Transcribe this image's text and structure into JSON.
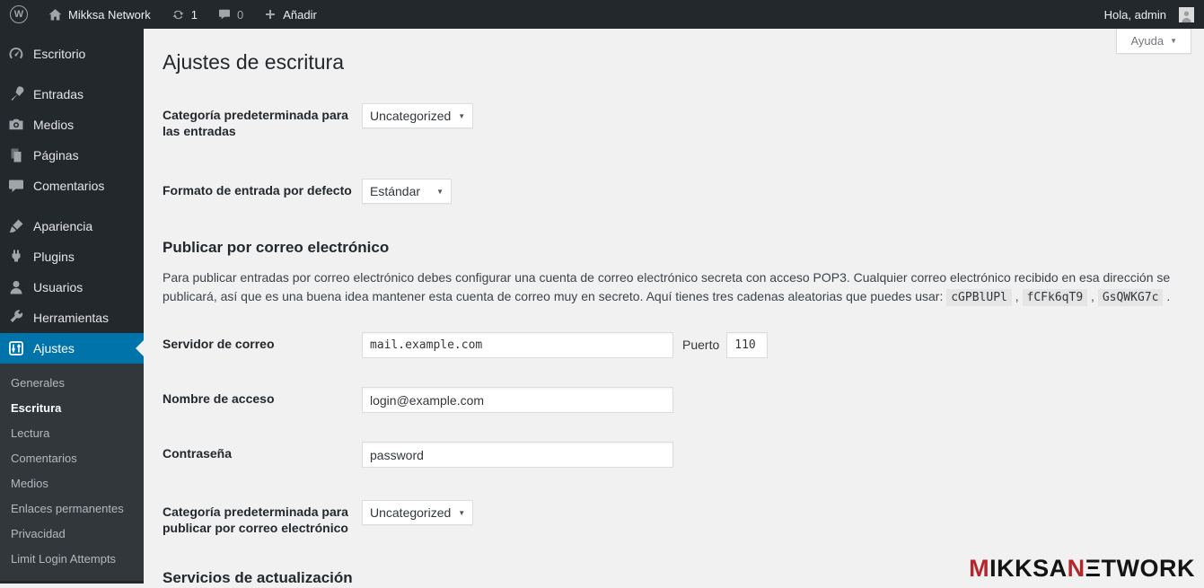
{
  "icons": {
    "chevron_down": "▼",
    "wp_w": "W",
    "plus": "+"
  },
  "admin_bar": {
    "site_name": "Mikksa Network",
    "updates_count": "1",
    "comments_count": "0",
    "add_new_label": "Añadir",
    "greeting": "Hola, admin"
  },
  "help": {
    "label": "Ayuda"
  },
  "sidebar": {
    "items": [
      {
        "label": "Escritorio"
      },
      {
        "label": "Entradas"
      },
      {
        "label": "Medios"
      },
      {
        "label": "Páginas"
      },
      {
        "label": "Comentarios"
      },
      {
        "label": "Apariencia"
      },
      {
        "label": "Plugins"
      },
      {
        "label": "Usuarios"
      },
      {
        "label": "Herramientas"
      },
      {
        "label": "Ajustes"
      }
    ],
    "submenu": [
      {
        "label": "Generales"
      },
      {
        "label": "Escritura"
      },
      {
        "label": "Lectura"
      },
      {
        "label": "Comentarios"
      },
      {
        "label": "Medios"
      },
      {
        "label": "Enlaces permanentes"
      },
      {
        "label": "Privacidad"
      },
      {
        "label": "Limit Login Attempts"
      }
    ]
  },
  "page": {
    "title": "Ajustes de escritura",
    "default_category": {
      "label": "Categoría predeterminada para las entradas",
      "value": "Uncategorized"
    },
    "default_format": {
      "label": "Formato de entrada por defecto",
      "value": "Estándar"
    },
    "mail_section": {
      "title": "Publicar por correo electrónico",
      "description": "Para publicar entradas por correo electrónico debes configurar una cuenta de correo electrónico secreta con acceso POP3. Cualquier correo electrónico recibido en esa dirección se publicará, así que es una buena idea mantener esta cuenta de correo muy en secreto. Aquí tienes tres cadenas aleatorias que puedes usar:",
      "codes": [
        "cGPBlUPl",
        "fCFk6qT9",
        "GsQWKG7c"
      ],
      "separator": ",",
      "period": ".",
      "server": {
        "label": "Servidor de correo",
        "value": "mail.example.com",
        "port_label": "Puerto",
        "port_value": "110"
      },
      "login": {
        "label": "Nombre de acceso",
        "value": "login@example.com"
      },
      "password": {
        "label": "Contraseña",
        "value": "password"
      },
      "category": {
        "label": "Categoría predeterminada para publicar por correo electrónico",
        "value": "Uncategorized"
      }
    },
    "update_section": {
      "title": "Servicios de actualización"
    },
    "watermark": {
      "part1": "M",
      "part2": "IKKSA",
      "part3": "N",
      "part4": "ΞTWORK"
    }
  }
}
